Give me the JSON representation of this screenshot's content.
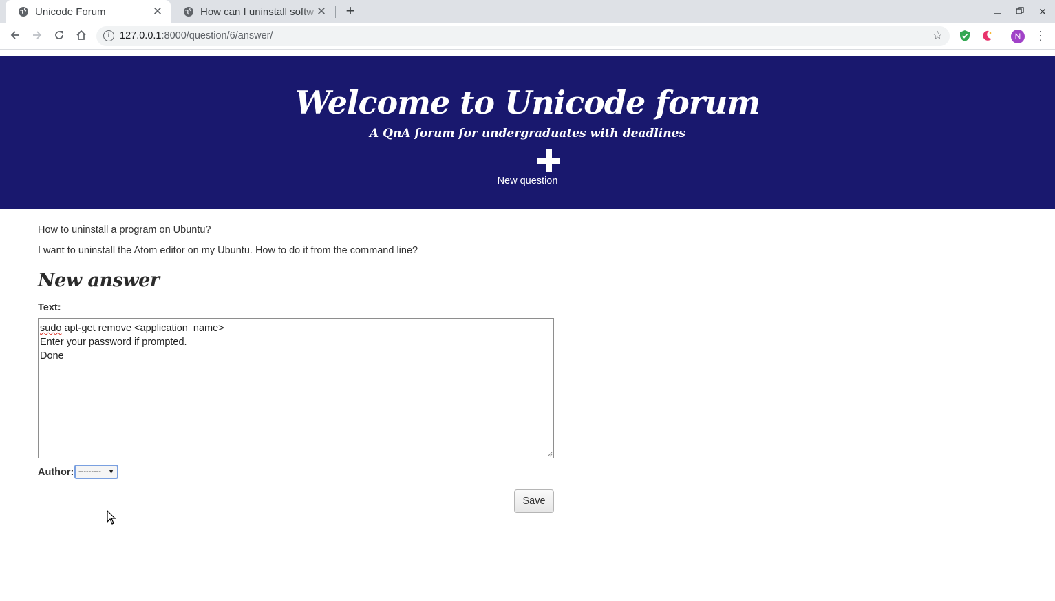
{
  "browser": {
    "tabs": [
      {
        "title": "Unicode Forum",
        "active": true
      },
      {
        "title": "How can I uninstall softw",
        "active": false
      }
    ],
    "address": {
      "host": "127.0.0.1",
      "path": ":8000/question/6/answer/"
    },
    "profile_initial": "N"
  },
  "hero": {
    "title": "Welcome to Unicode forum",
    "subtitle": "A QnA forum for undergraduates with deadlines",
    "new_question_label": "New question",
    "background": "#19186e"
  },
  "question": {
    "title": "How to uninstall a program on Ubuntu?",
    "body": "I want to uninstall the Atom editor on my Ubuntu. How to do it from the command line?"
  },
  "answer_form": {
    "heading": "New answer",
    "text_label": "Text:",
    "text_lines": {
      "first_word": "sudo",
      "line1_rest": " apt-get remove <application_name>",
      "line2": "Enter your password if prompted.",
      "line3": "Done"
    },
    "author_label": "Author:",
    "author_value": "---------",
    "save_label": "Save"
  }
}
